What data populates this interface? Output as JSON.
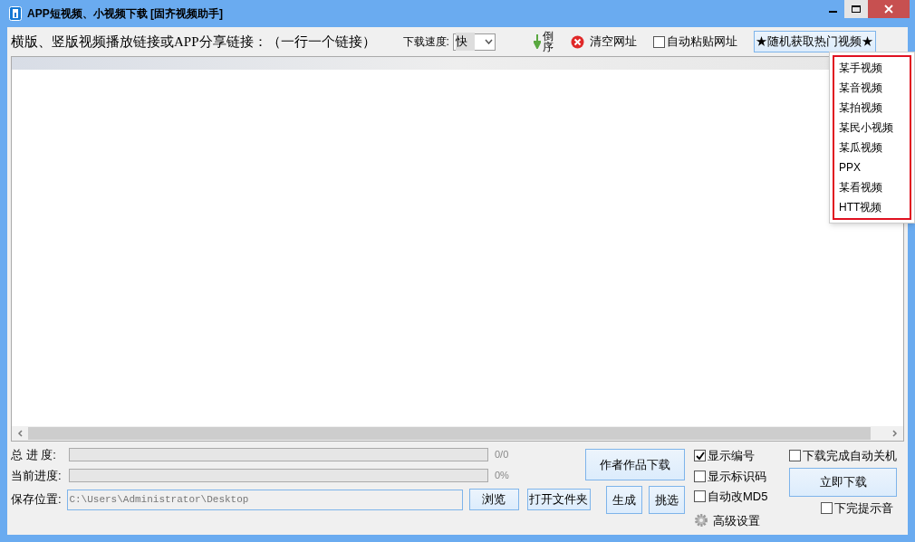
{
  "window": {
    "title": "APP短视频、小视频下载 [固齐视频助手]"
  },
  "toolbar": {
    "prompt": "横版、竖版视频播放链接或APP分享链接：（一行一个链接）",
    "speed_label": "下载速度:",
    "speed_value": "快",
    "reverse_button": "倒序",
    "clear_button": "清空网址",
    "auto_paste": {
      "label": "自动粘贴网址",
      "checked": false
    },
    "hot_button": "★随机获取热门视频★"
  },
  "hot_menu": [
    {
      "label": "某手视频"
    },
    {
      "label": "某音视频"
    },
    {
      "label": "某拍视频"
    },
    {
      "label": "某民小视频"
    },
    {
      "label": "某瓜视频"
    },
    {
      "label": "PPX"
    },
    {
      "label": "某看视频"
    },
    {
      "label": "HTT视频"
    }
  ],
  "progress": [
    {
      "label": "总 进 度:",
      "level": 0,
      "reading": "0/0"
    },
    {
      "label": "当前进度:",
      "level": 0,
      "reading": "0%"
    }
  ],
  "save": {
    "label": "保存位置:",
    "value": "C:\\Users\\Administrator\\Desktop",
    "browse": "浏览",
    "open_folder": "打开文件夹"
  },
  "author_button": "作者作品下载",
  "generate_button": "生成",
  "pick_button": "挑选",
  "options": [
    {
      "label": "显示编号",
      "checked": true
    },
    {
      "label": "显示标识码",
      "checked": false
    },
    {
      "label": "自动改MD5",
      "checked": false
    }
  ],
  "advanced": "高级设置",
  "shutdown": {
    "label": "下载完成自动关机",
    "checked": false
  },
  "download_button": "立即下载",
  "sound": {
    "label": "下完提示音",
    "checked": false
  }
}
